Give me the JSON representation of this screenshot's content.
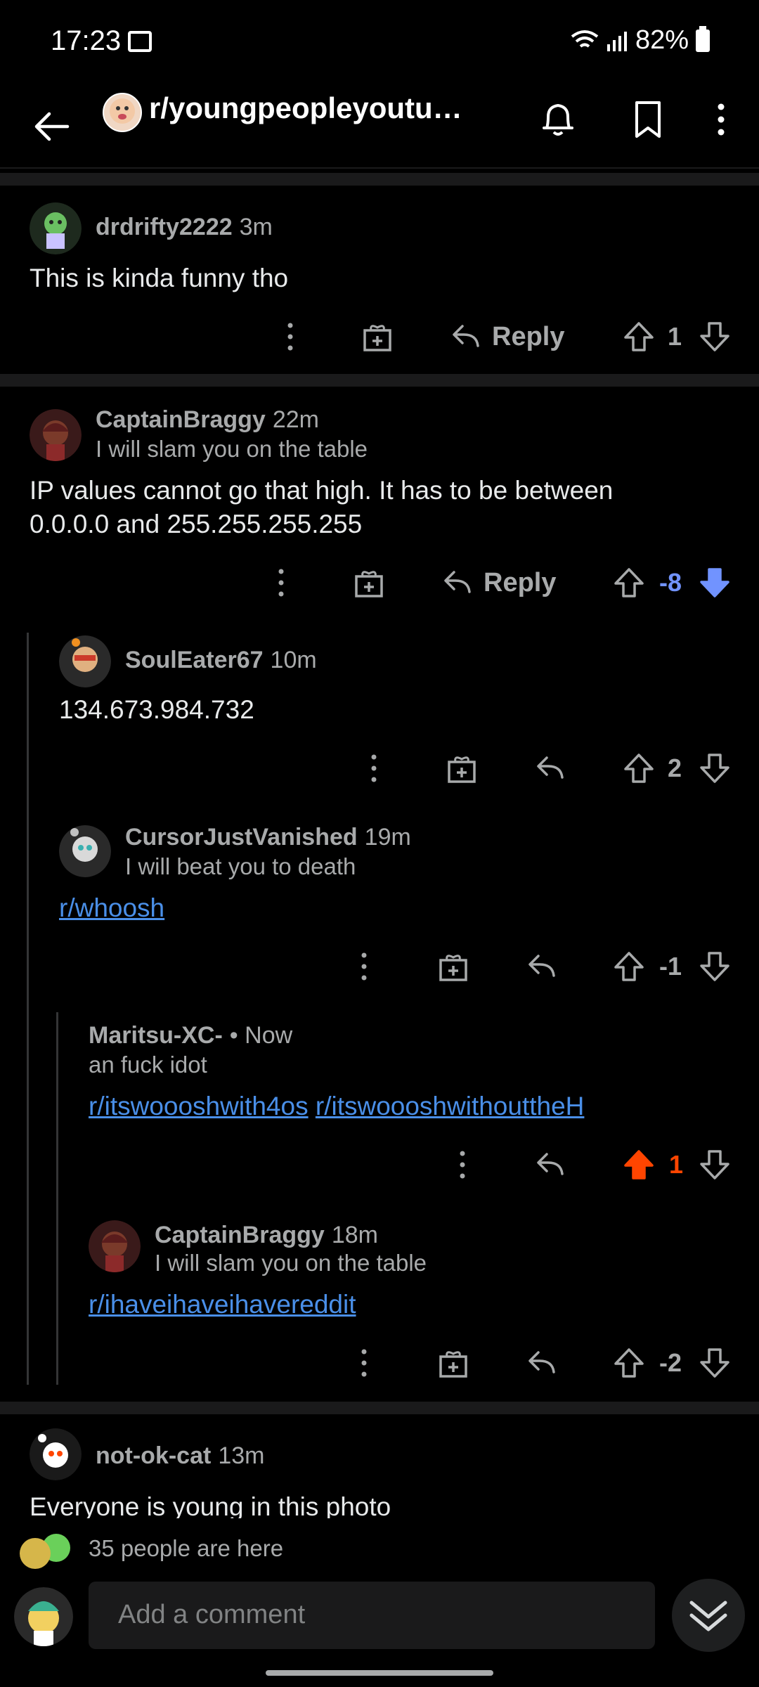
{
  "status_bar": {
    "time": "17:23",
    "battery": "82%"
  },
  "header": {
    "subreddit": "r/youngpeopleyoutu…"
  },
  "comments": [
    {
      "user": "drdrifty2222",
      "age": "3m",
      "body": "This is kinda funny tho",
      "reply": "Reply",
      "score": "1"
    },
    {
      "user": "CaptainBraggy",
      "age": "22m",
      "flair": "I will slam you on the table",
      "body_line1": "IP values cannot go that high. It has to be between",
      "body_line2": "0.0.0.0 and 255.255.255.255",
      "reply": "Reply",
      "score": "-8"
    },
    {
      "user": "SoulEater67",
      "age": "10m",
      "body": "134.673.984.732",
      "score": "2"
    },
    {
      "user": "CursorJustVanished",
      "age": "19m",
      "flair": "I will beat you to death",
      "body": "r/whoosh",
      "score": "-1"
    },
    {
      "user": "Maritsu-XC-",
      "age": "• Now",
      "flair": "an fuck idot",
      "link1": "r/itswoooshwith4os",
      "link2": "r/itswoooshwithouttheH",
      "score": "1"
    },
    {
      "user": "CaptainBraggy",
      "age": "18m",
      "flair": "I will slam you on the table",
      "body": "r/ihaveihaveihavereddit",
      "score": "-2"
    },
    {
      "user": "not-ok-cat",
      "age": "13m",
      "body": "Everyone is young in this photo"
    }
  ],
  "footer": {
    "presence": "35 people are here",
    "placeholder": "Add a comment"
  },
  "colors": {
    "downvote_active": "#7193ff",
    "upvote_active": "#ff4500"
  }
}
